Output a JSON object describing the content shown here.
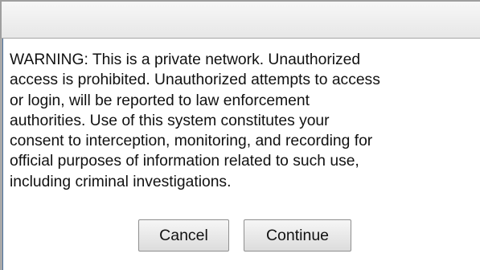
{
  "dialog": {
    "title": "",
    "message": "WARNING: This is a private network. Unauthorized\naccess is prohibited. Unauthorized attempts to access\nor login, will be reported to law enforcement\nauthorities. Use of this system constitutes your\nconsent to interception, monitoring, and recording for\nofficial purposes of information related to such use,\nincluding criminal investigations.",
    "buttons": {
      "cancel_label": "Cancel",
      "continue_label": "Continue"
    }
  }
}
